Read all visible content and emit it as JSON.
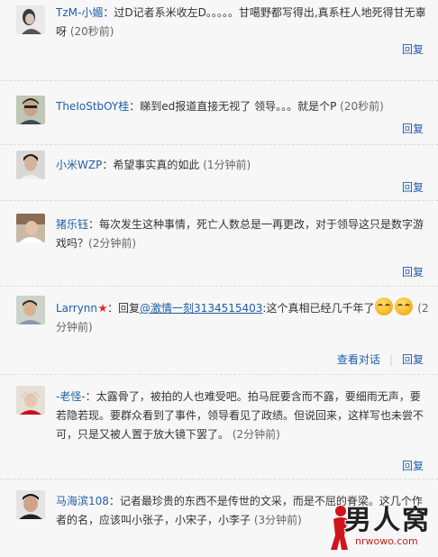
{
  "comments": [
    {
      "user": "TzM-小媚",
      "text": "过D记者系米收左D。。。。。甘噶野都写得出,真系枉人地死得甘无辜呀",
      "time": "(20秒前)",
      "reply": "回复"
    },
    {
      "user": "TheIoStbOY桂",
      "text": "睇到ed报道直接无视了 领导。。。就是个P",
      "time": "(20秒前)",
      "reply": "回复"
    },
    {
      "user": "小米WZP",
      "text": "希望事实真的如此",
      "time": "(1分钟前)",
      "reply": "回复"
    },
    {
      "user": "猪乐钰",
      "text": "每次发生这种事情，死亡人数总是一再更改，对于领导这只是数字游戏吗？",
      "time": "(2分钟前)",
      "reply": "回复"
    },
    {
      "user": "Larrynn",
      "prefix": "回复",
      "mention": "@激情一刻3134515403",
      "text": ":这个真相已经几千年了",
      "time": "(2分钟前)",
      "view_conversation": "查看对话",
      "reply": "回复"
    },
    {
      "user": "-老怪-",
      "text": "太露骨了，被拍的人也难受吧。拍马屁要含而不露，要细雨无声，要若隐若现。要群众看到了事件，领导看见了政绩。但说回来，这样写也未尝不可，只是又被人置于放大镜下罢了。",
      "time": "(2分钟前)",
      "reply": "回复"
    },
    {
      "user": "马海滨108",
      "text": "记者最珍贵的东西不是传世的文采，而是不屈的脊梁。这几个作者的名，应该叫小张子，小宋子，小李子",
      "time": "(3分钟前)"
    }
  ],
  "watermark": {
    "logo_text": "男人窝",
    "url": "nrwowo.com"
  }
}
